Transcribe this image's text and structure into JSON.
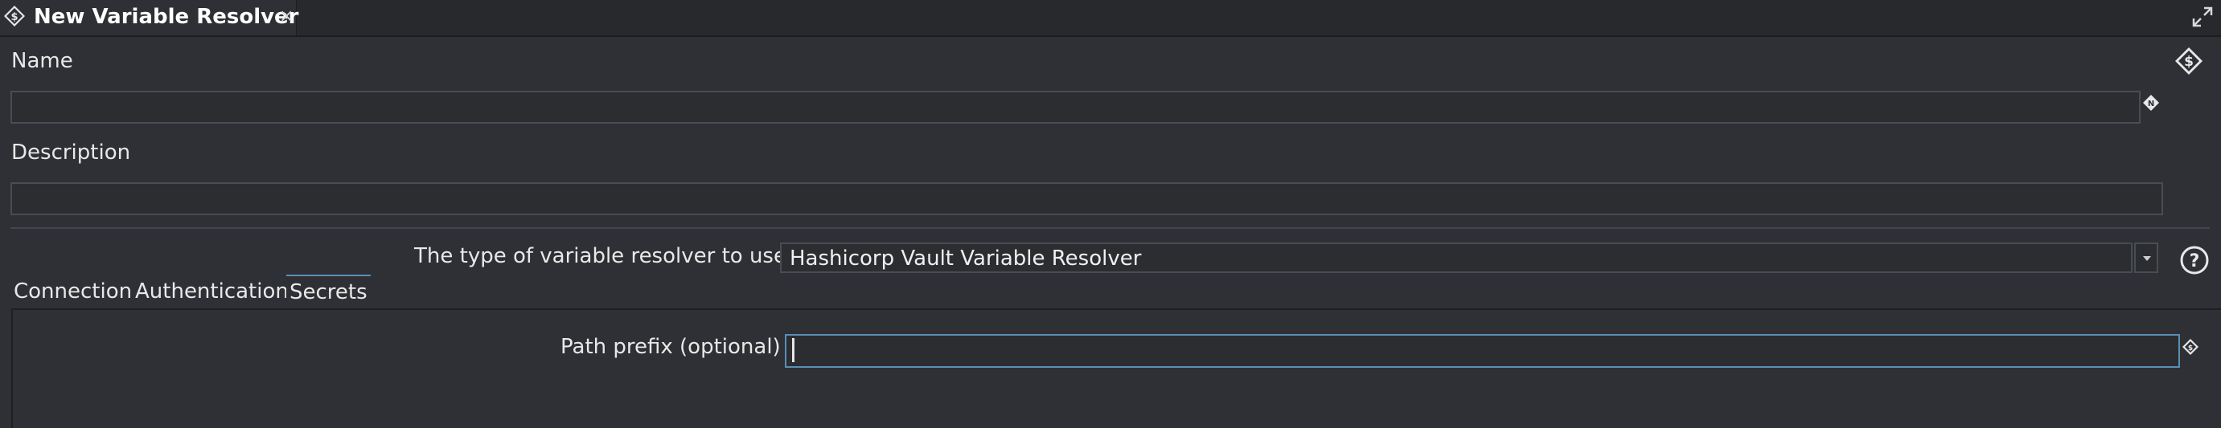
{
  "editor": {
    "tab_title": "New Variable Resolver",
    "close_label": "×"
  },
  "form": {
    "name_label": "Name",
    "name_value": "",
    "description_label": "Description",
    "description_value": "",
    "type_label": "The type of variable resolver to use",
    "type_value": "Hashicorp Vault Variable Resolver"
  },
  "tabs": [
    {
      "label": "Connection",
      "active": false
    },
    {
      "label": "Authentication",
      "active": false
    },
    {
      "label": "Secrets",
      "active": true
    }
  ],
  "secrets": {
    "path_prefix_label": "Path prefix (optional)",
    "path_prefix_value": ""
  },
  "icons": {
    "tab": "variable-dollar-icon",
    "maximize": "maximize-icon",
    "header": "variable-dollar-icon",
    "name_field": "translate-icon",
    "help": "help-icon",
    "path_field": "variable-dollar-icon"
  },
  "colors": {
    "background": "#2e3035",
    "accent": "#5a8fb5"
  }
}
